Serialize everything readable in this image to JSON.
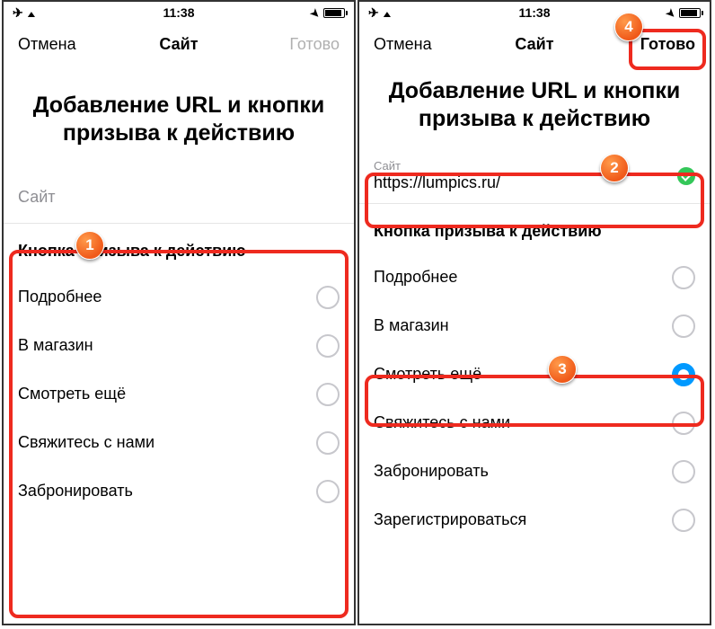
{
  "statusbar": {
    "time": "11:38"
  },
  "nav": {
    "cancel": "Отмена",
    "title": "Сайт",
    "done": "Готово"
  },
  "headline": "Добавление URL и кнопки призыва к действию",
  "left": {
    "site_placeholder": "Сайт",
    "section": "Кнопка призыва к действию",
    "options": [
      "Подробнее",
      "В магазин",
      "Смотреть ещё",
      "Свяжитесь с нами",
      "Забронировать"
    ]
  },
  "right": {
    "site_label": "Сайт",
    "site_value": "https://lumpics.ru/",
    "section": "Кнопка призыва к действию",
    "options": [
      "Подробнее",
      "В магазин",
      "Смотреть ещё",
      "Свяжитесь с нами",
      "Забронировать",
      "Зарегистрироваться"
    ],
    "selected_index": 2
  },
  "callouts": {
    "c1": "1",
    "c2": "2",
    "c3": "3",
    "c4": "4"
  }
}
